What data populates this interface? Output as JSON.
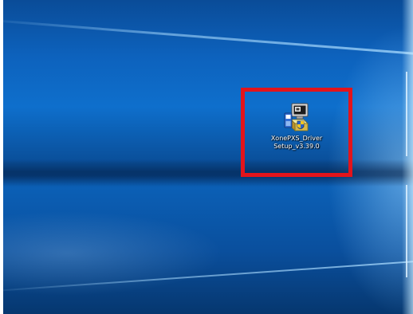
{
  "desktop": {
    "icons": [
      {
        "label": "XonePXS_DriverSetup_v3.39.0",
        "icon": "installer-setup-icon",
        "selected_highlight": true
      }
    ]
  },
  "colors": {
    "wallpaper_blue": "#0e6fcc",
    "highlight_border": "#e3141b",
    "label_text": "#ffffff"
  }
}
